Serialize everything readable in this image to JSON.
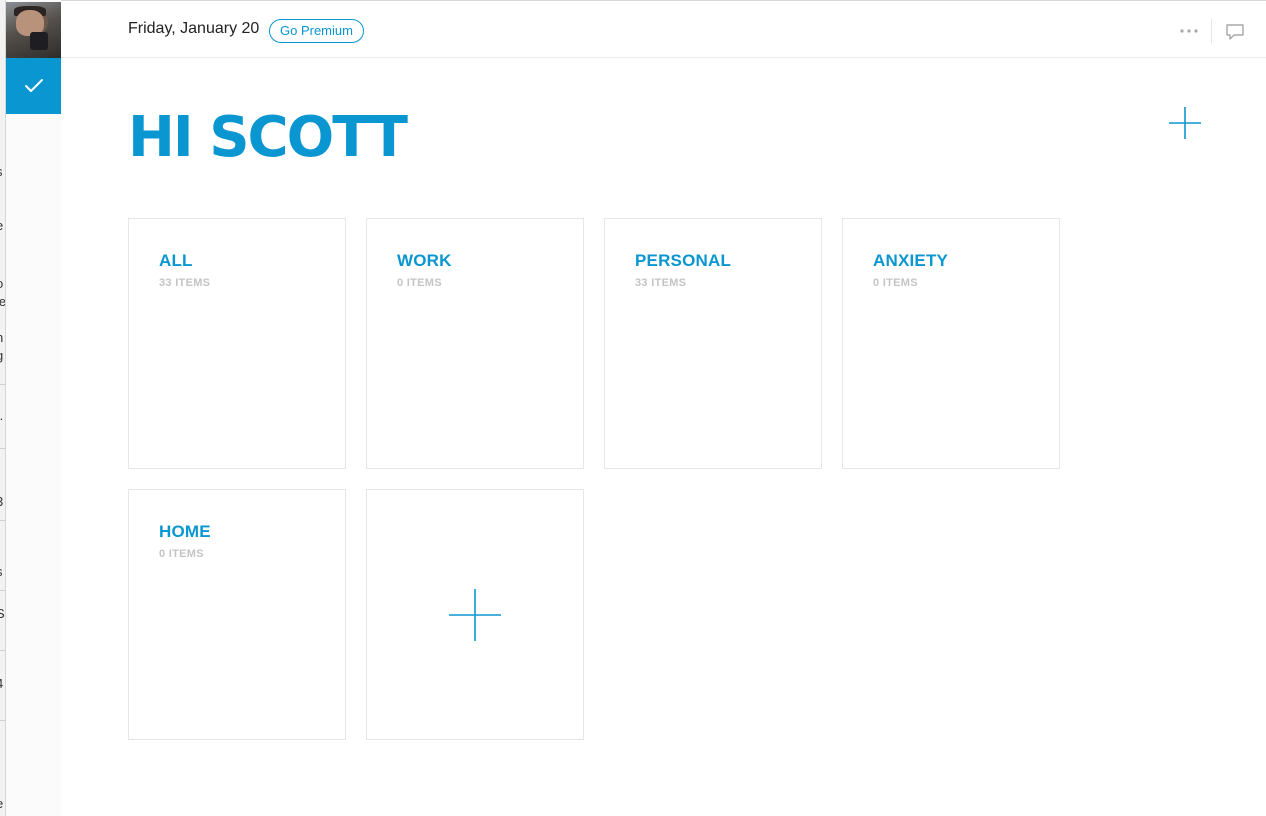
{
  "header": {
    "date": "Friday, January 20",
    "premium_label": "Go Premium"
  },
  "greeting": "HI SCOTT",
  "lists": [
    {
      "title": "ALL",
      "count": "33 ITEMS"
    },
    {
      "title": "WORK",
      "count": "0 ITEMS"
    },
    {
      "title": "PERSONAL",
      "count": "33 ITEMS"
    },
    {
      "title": "ANXIETY",
      "count": "0 ITEMS"
    },
    {
      "title": "HOME",
      "count": "0 ITEMS"
    }
  ],
  "background_window_fragments": [
    "s",
    "e",
    ",",
    "o",
    "ie",
    "n",
    "g",
    "..",
    "3",
    "s",
    "S",
    "4",
    "e"
  ],
  "colors": {
    "accent": "#0a96d0",
    "muted": "#c4c4c4",
    "text": "#222222"
  },
  "icons": {
    "avatar": "user-avatar-photo",
    "check": "checkmark-icon",
    "more": "more-dots-icon",
    "chat": "chat-bubble-icon",
    "add": "plus-icon"
  }
}
